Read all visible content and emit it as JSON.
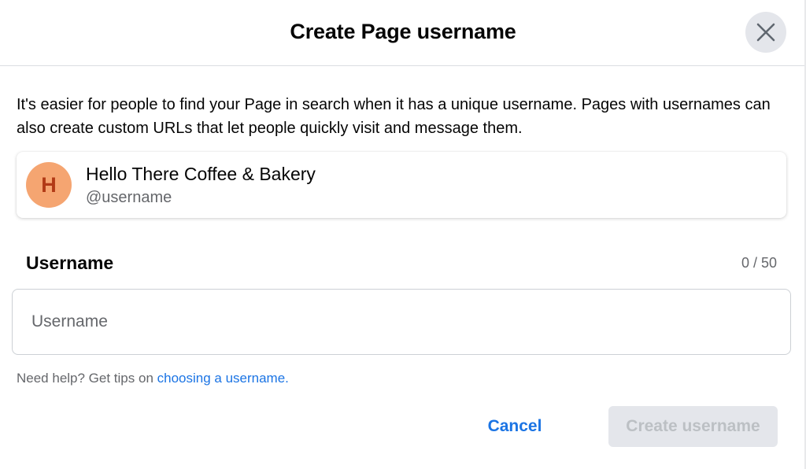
{
  "dialog": {
    "title": "Create Page username",
    "close_icon": "close-icon"
  },
  "description": "It's easier for people to find your Page in search when it has a unique username. Pages with usernames can also create custom URLs that let people quickly visit and message them.",
  "page": {
    "avatar_letter": "H",
    "avatar_color": "#f5a571",
    "avatar_text_color": "#b23a16",
    "name": "Hello There Coffee & Bakery",
    "handle": "@username"
  },
  "field": {
    "label": "Username",
    "counter": "0 / 50",
    "value": "",
    "placeholder": "Username"
  },
  "help": {
    "prefix": "Need help? Get tips on ",
    "link_text": "choosing a username."
  },
  "actions": {
    "cancel_label": "Cancel",
    "create_label": "Create username"
  },
  "colors": {
    "link_blue": "#1b74e4",
    "secondary_text": "#65676b",
    "disabled_bg": "#e4e6eb",
    "disabled_text": "#bcc0c4"
  }
}
